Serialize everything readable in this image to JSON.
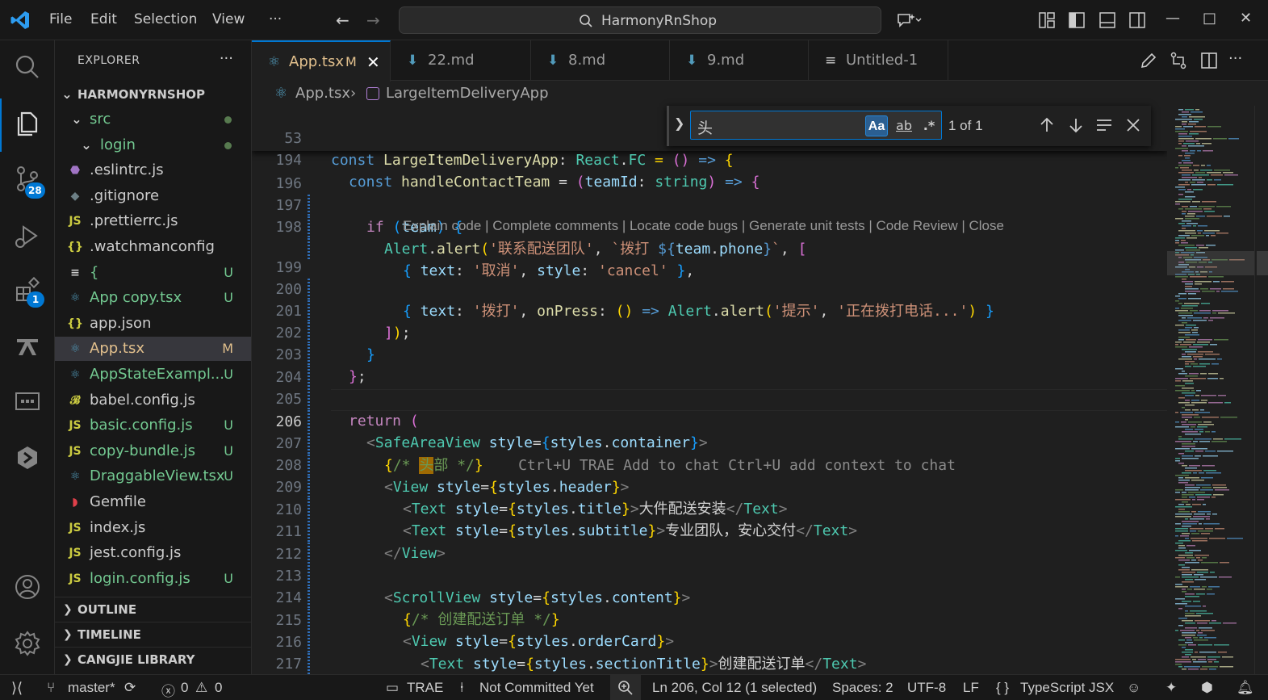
{
  "titlebar": {
    "menu": [
      "File",
      "Edit",
      "Selection",
      "View",
      "···"
    ],
    "search_label": "HarmonyRnShop",
    "window_controls": [
      "—",
      "□",
      "✕"
    ]
  },
  "activity": {
    "source_control_badge": "28",
    "extensions_badge": "1"
  },
  "sidebar": {
    "title": "EXPLORER",
    "more": "···",
    "root": "HARMONYRNSHOP",
    "items": [
      {
        "label": "src",
        "icon": "⌄",
        "color": "#73c991",
        "status": "dot"
      },
      {
        "label": "login",
        "icon": "⌄",
        "color": "#73c991",
        "status": "dot"
      },
      {
        "label": ".eslintrc.js",
        "icon": "⬣",
        "iconColor": "#a074c4",
        "color": "#cccccc",
        "status": ""
      },
      {
        "label": ".gitignore",
        "icon": "◆",
        "iconColor": "#6d8086",
        "color": "#cccccc",
        "status": ""
      },
      {
        "label": ".prettierrc.js",
        "icon": "JS",
        "iconColor": "#cbcb41",
        "color": "#cccccc",
        "status": ""
      },
      {
        "label": ".watchmanconfig",
        "icon": "{}",
        "iconColor": "#cbcb41",
        "color": "#cccccc",
        "status": ""
      },
      {
        "label": "{",
        "icon": "≡",
        "iconColor": "#cccccc",
        "color": "#73c991",
        "status": "U"
      },
      {
        "label": "App copy.tsx",
        "icon": "⚛",
        "iconColor": "#519aba",
        "color": "#73c991",
        "status": "U"
      },
      {
        "label": "app.json",
        "icon": "{}",
        "iconColor": "#cbcb41",
        "color": "#cccccc",
        "status": ""
      },
      {
        "label": "App.tsx",
        "icon": "⚛",
        "iconColor": "#519aba",
        "color": "#e2c08d",
        "status": "M"
      },
      {
        "label": "AppStateExampl...",
        "icon": "⚛",
        "iconColor": "#519aba",
        "color": "#73c991",
        "status": "U"
      },
      {
        "label": "babel.config.js",
        "icon": "𝓑",
        "iconColor": "#cbcb41",
        "color": "#cccccc",
        "status": ""
      },
      {
        "label": "basic.config.js",
        "icon": "JS",
        "iconColor": "#cbcb41",
        "color": "#73c991",
        "status": "U"
      },
      {
        "label": "copy-bundle.js",
        "icon": "JS",
        "iconColor": "#cbcb41",
        "color": "#73c991",
        "status": "U"
      },
      {
        "label": "DraggableView.tsx",
        "icon": "⚛",
        "iconColor": "#519aba",
        "color": "#73c991",
        "status": "U"
      },
      {
        "label": "Gemfile",
        "icon": "◗",
        "iconColor": "#e0404a",
        "color": "#cccccc",
        "status": ""
      },
      {
        "label": "index.js",
        "icon": "JS",
        "iconColor": "#cbcb41",
        "color": "#cccccc",
        "status": ""
      },
      {
        "label": "jest.config.js",
        "icon": "JS",
        "iconColor": "#cbcb41",
        "color": "#cccccc",
        "status": ""
      },
      {
        "label": "login.config.js",
        "icon": "JS",
        "iconColor": "#cbcb41",
        "color": "#73c991",
        "status": "U"
      }
    ],
    "sections": [
      "OUTLINE",
      "TIMELINE",
      "CANGJIE LIBRARY"
    ]
  },
  "tabs": [
    {
      "label": "App.tsx",
      "icon": "⚛",
      "status": "M",
      "active": true
    },
    {
      "label": "22.md",
      "icon": "⬇",
      "status": "",
      "active": false
    },
    {
      "label": "8.md",
      "icon": "⬇",
      "status": "",
      "active": false
    },
    {
      "label": "9.md",
      "icon": "⬇",
      "status": "",
      "active": false
    },
    {
      "label": "Untitled-1",
      "icon": "≡",
      "status": "",
      "active": false
    }
  ],
  "breadcrumb": {
    "file": "App.tsx",
    "symbol": "LargeItemDeliveryApp"
  },
  "find": {
    "query": "头",
    "match_case": "Aa",
    "whole_word": "ab",
    "regex": ".*",
    "count": "1 of 1"
  },
  "editor": {
    "sticky_lines": [
      "53",
      "194"
    ],
    "line_numbers": [
      "196",
      "197",
      "198",
      "199",
      "200",
      "201",
      "202",
      "203",
      "204",
      "205",
      "206",
      "207",
      "208",
      "209",
      "210",
      "211",
      "212",
      "213",
      "214",
      "215",
      "216",
      "217"
    ],
    "current_line": "206",
    "codelens": "Explain code | Complete comments | Locate code bugs | Generate unit tests | Code Review | Close",
    "ghost_hint": "Ctrl+U TRAE Add to chat Ctrl+U add context to chat"
  },
  "statusbar": {
    "branch": "master*",
    "errors": "0",
    "warnings": "0",
    "trae": "TRAE",
    "commit": "Not Committed Yet",
    "position": "Ln 206, Col 12 (1 selected)",
    "spaces": "Spaces: 2",
    "encoding": "UTF-8",
    "eol": "LF",
    "language": "TypeScript JSX"
  },
  "colors": {
    "accent": "#0078d4",
    "untracked": "#73c991",
    "modified": "#e2c08d"
  }
}
